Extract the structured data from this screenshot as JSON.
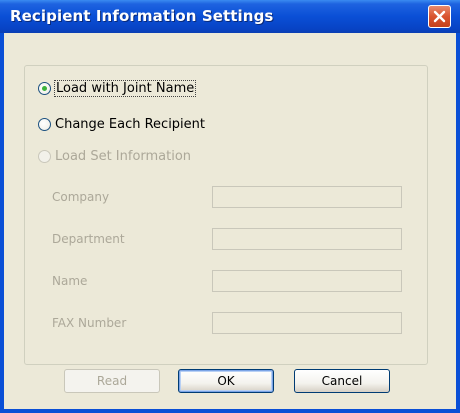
{
  "window": {
    "title": "Recipient Information Settings",
    "close_icon": "close-icon"
  },
  "options": {
    "load_joint_name": {
      "label": "Load with Joint Name",
      "selected": true
    },
    "change_each_recipient": {
      "label": "Change Each Recipient",
      "selected": false
    },
    "load_set_information": {
      "label": "Load Set Information",
      "selected": false,
      "enabled": false
    }
  },
  "fields": {
    "company": {
      "label": "Company",
      "value": ""
    },
    "department": {
      "label": "Department",
      "value": ""
    },
    "name": {
      "label": "Name",
      "value": ""
    },
    "fax_number": {
      "label": "FAX Number",
      "value": ""
    }
  },
  "buttons": {
    "read": "Read",
    "ok": "OK",
    "cancel": "Cancel"
  },
  "colors": {
    "titlebar": "#0a4fd6",
    "window_bg": "#ece9d8",
    "close_button": "#d9542f",
    "radio_selected": "#3cb23c",
    "disabled_text": "#aca899"
  }
}
